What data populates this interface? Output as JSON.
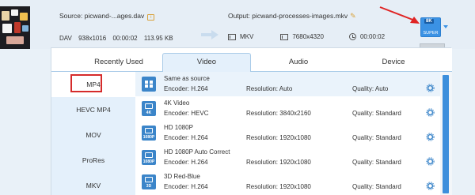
{
  "source": {
    "label": "Source: picwand-...ages.dav",
    "info_icon": "i",
    "format": "DAV",
    "resolution": "938x1016",
    "duration": "00:00:02",
    "size": "113.95 KB"
  },
  "output": {
    "label": "Output: picwand-processes-images.mkv",
    "format": "MKV",
    "resolution": "7680x4320",
    "duration": "00:00:02",
    "format_button": {
      "badge": "8K",
      "label": "SUPER"
    }
  },
  "tabs": [
    {
      "label": "Recently Used"
    },
    {
      "label": "Video"
    },
    {
      "label": "Audio"
    },
    {
      "label": "Device"
    }
  ],
  "active_tab": "Video",
  "sidebar": {
    "items": [
      {
        "label": "MP4"
      },
      {
        "label": "HEVC MP4"
      },
      {
        "label": "MOV"
      },
      {
        "label": "ProRes"
      },
      {
        "label": "MKV"
      }
    ],
    "selected": "MP4"
  },
  "presets": [
    {
      "name": "Same as source",
      "encoder": "Encoder: H.264",
      "resolution": "Resolution: Auto",
      "quality": "Quality: Auto",
      "icon_caption": ""
    },
    {
      "name": "4K Video",
      "encoder": "Encoder: HEVC",
      "resolution": "Resolution: 3840x2160",
      "quality": "Quality: Standard",
      "icon_caption": "4K"
    },
    {
      "name": "HD 1080P",
      "encoder": "Encoder: H.264",
      "resolution": "Resolution: 1920x1080",
      "quality": "Quality: Standard",
      "icon_caption": "1080P"
    },
    {
      "name": "HD 1080P Auto Correct",
      "encoder": "Encoder: H.264",
      "resolution": "Resolution: 1920x1080",
      "quality": "Quality: Standard",
      "icon_caption": "1080P"
    },
    {
      "name": "3D Red-Blue",
      "encoder": "Encoder: H.264",
      "resolution": "Resolution: 1920x1080",
      "quality": "Quality: Standard",
      "icon_caption": "3D"
    }
  ],
  "colors": {
    "accent": "#3b92e4",
    "highlight_box": "#d52b2b",
    "sidebar_bg": "#e4f0fb"
  }
}
